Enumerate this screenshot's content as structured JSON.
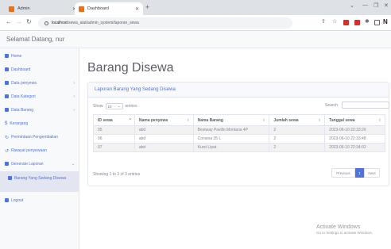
{
  "browser": {
    "tabs": [
      {
        "title": "Admin",
        "active": false
      },
      {
        "title": "Dashboard",
        "active": true
      }
    ],
    "url_host": "localhost",
    "url_path": "/sewa_alat/admin_system/laporan_sewa"
  },
  "topbar": {
    "welcome": "Selamat Datang, nur"
  },
  "sidebar": {
    "items": [
      {
        "label": "Home",
        "icon": "home-icon",
        "chevron": false
      },
      {
        "label": "Dashboard",
        "icon": "dashboard-icon",
        "chevron": false
      },
      {
        "label": "Data penyewa",
        "icon": "users-icon",
        "chevron": true
      },
      {
        "label": "Data Kategori",
        "icon": "tags-icon",
        "chevron": true
      },
      {
        "label": "Data Barang",
        "icon": "box-icon",
        "chevron": true
      },
      {
        "label": "Keranjang",
        "icon": "dollar-icon",
        "chevron": false
      },
      {
        "label": "Permintaan Pengembalian",
        "icon": "refresh-icon",
        "chevron": false
      },
      {
        "label": "Riwayat penyewaan",
        "icon": "history-icon",
        "chevron": false
      },
      {
        "label": "Generate Laporan",
        "icon": "report-icon",
        "chevron": true
      },
      {
        "label": "Barang Yang Sedang Disewa",
        "icon": "report-icon",
        "chevron": false
      },
      {
        "label": "Logout",
        "icon": "logout-icon",
        "chevron": false
      }
    ]
  },
  "main": {
    "title": "Barang Disewa",
    "card_header": "Laporan Barang Yang Sedang Disewa",
    "show_label": "Show",
    "show_value": "10",
    "entries_label": "entries",
    "search_label": "Search:",
    "columns": [
      "ID sewa",
      "Nama penyewa",
      "Nama Barang",
      "Jumlah sewa",
      "Tanggal sewa"
    ],
    "rows": [
      [
        "05",
        "abd",
        "Bestway Pavillo Montana 4P",
        "2",
        "2023-06-10 22:33:26"
      ],
      [
        "06",
        "abd",
        "Consina 35 L",
        "2",
        "2023-06-10 22:33:48"
      ],
      [
        "07",
        "abd",
        "Kursi Lipat",
        "2",
        "2023-06-10 22:34:02"
      ]
    ],
    "info": "Showing 1 to 3 of 3 entries",
    "pager": {
      "prev": "Previous",
      "page": "1",
      "next": "Next"
    }
  },
  "watermark": {
    "line1": "Activate Windows",
    "line2": "Go to Settings to activate Windows."
  },
  "colors": {
    "accent": "#4e73df",
    "sidebar_bg": "#f8f9fa",
    "text_muted": "#858796"
  }
}
